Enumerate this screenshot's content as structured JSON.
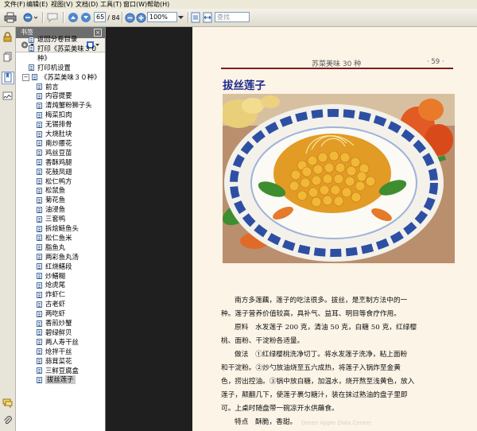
{
  "menubar": {
    "items": [
      "文件(F)",
      "编辑(E)",
      "视图(V)",
      "文档(D)",
      "工具(T)",
      "窗口(W)",
      "帮助(H)"
    ]
  },
  "toolbar": {
    "page_current": "65",
    "page_total": "/ 84",
    "zoom": "100%",
    "find_placeholder": "查找"
  },
  "sidebar_tools": [
    "lock-icon",
    "pages-icon",
    "bookmarks-icon",
    "signatures-icon",
    "comments-icon",
    "attachments-icon"
  ],
  "panel": {
    "title": "书签",
    "close": "×",
    "bookmarks": [
      {
        "label": "返回分卷目录",
        "level": 0
      },
      {
        "label": "打印《苏菜美味３０",
        "level": 0
      },
      {
        "label": "种》",
        "level": 0,
        "cont": true
      },
      {
        "label": "打印机设置",
        "level": 0
      },
      {
        "label": "《苏菜美味３０种》",
        "level": 0,
        "expanded": true
      },
      {
        "label": "前言",
        "level": 1
      },
      {
        "label": "内容提要",
        "level": 1
      },
      {
        "label": "清炖蟹粉狮子头",
        "level": 1
      },
      {
        "label": "梅菜扣肉",
        "level": 1
      },
      {
        "label": "无锡排骨",
        "level": 1
      },
      {
        "label": "大烧肚块",
        "level": 1
      },
      {
        "label": "南炒腰花",
        "level": 1
      },
      {
        "label": "鸡丝豆苗",
        "level": 1
      },
      {
        "label": "香酥鸡腿",
        "level": 1
      },
      {
        "label": "花鼓凤翅",
        "level": 1
      },
      {
        "label": "松仁鸭方",
        "level": 1
      },
      {
        "label": "松鼠鱼",
        "level": 1
      },
      {
        "label": "菊花鱼",
        "level": 1
      },
      {
        "label": "油浸鱼",
        "level": 1
      },
      {
        "label": "三套鸭",
        "level": 1
      },
      {
        "label": "拆烩鲢鱼头",
        "level": 1
      },
      {
        "label": "松仁鱼米",
        "level": 1
      },
      {
        "label": "脂鱼丸",
        "level": 1
      },
      {
        "label": "两彩鱼丸汤",
        "level": 1
      },
      {
        "label": "红烧鳝段",
        "level": 1
      },
      {
        "label": "炒鳝糊",
        "level": 1
      },
      {
        "label": "炝虎尾",
        "level": 1
      },
      {
        "label": "炸虾仁",
        "level": 1
      },
      {
        "label": "古老虾",
        "level": 1
      },
      {
        "label": "两吃虾",
        "level": 1
      },
      {
        "label": "香煎炒蟹",
        "level": 1
      },
      {
        "label": "碧绿鲜贝",
        "level": 1
      },
      {
        "label": "两人寿干丝",
        "level": 1
      },
      {
        "label": "炝拌干丝",
        "level": 1
      },
      {
        "label": "蒜茸菜花",
        "level": 1
      },
      {
        "label": "三鲜豆腐盒",
        "level": 1
      },
      {
        "label": "拔丝莲子",
        "level": 1,
        "selected": true
      }
    ]
  },
  "page": {
    "running_title": "苏菜美味 30 种",
    "page_number": "· 59 ·",
    "section_title": "拔丝莲子",
    "body": [
      "南方多莲藕，莲子的吃法很多。拔丝，是烹制方法中的一",
      "种。莲子营养价值较高，具补气、益耳、明目等食疗作用。",
      "原料　水发莲子 200 克，清油 50 克，白糖 50 克，红绿樱",
      "桃、面粉、干淀粉各适量。",
      "做法　①红绿樱桃洗净切丁。将水发莲子洗净，粘上面粉",
      "和干淀粉。②炒勺放油烧至五六成热，将莲子入锅炸至金黄",
      "色，捞出控油。③锅中放白糖，加温水，烧开熬至浅黄色，放入",
      "莲子，颠翻几下，使莲子裹匀糖汁，装在抹过熟油的盘子里即",
      "可。上桌时随盘带一碗凉开水供蘸食。",
      "特点　酥脆，香甜。"
    ],
    "watermark": "Green Apple Data Center"
  }
}
